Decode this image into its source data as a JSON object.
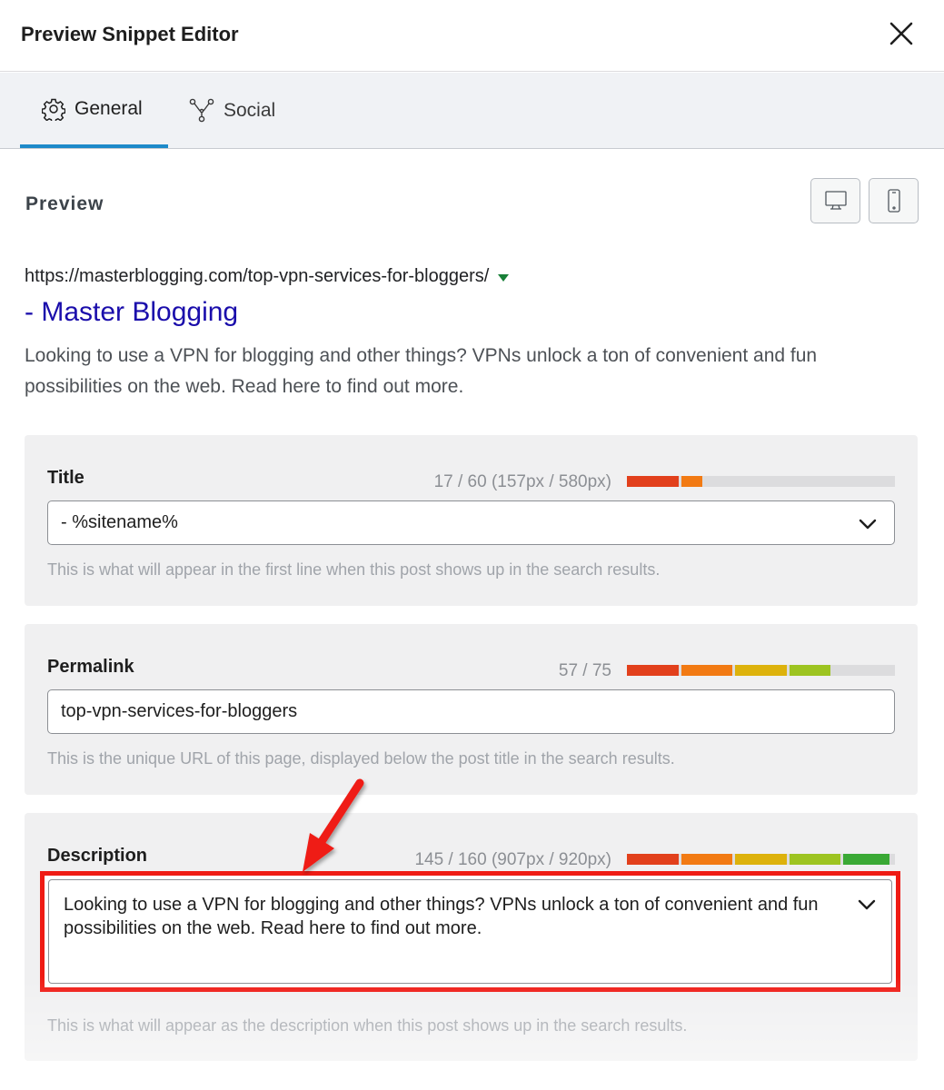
{
  "header": {
    "title": "Preview Snippet Editor",
    "close_icon": "close-icon"
  },
  "tabs": [
    {
      "label": "General",
      "icon": "gear-icon",
      "active": true
    },
    {
      "label": "Social",
      "icon": "share-network-icon",
      "active": false
    }
  ],
  "preview": {
    "label": "Preview",
    "device_buttons": [
      "desktop-icon",
      "mobile-icon"
    ],
    "url": "https://masterblogging.com/top-vpn-services-for-bloggers/",
    "title": "- Master Blogging",
    "description": "Looking to use a VPN for blogging and other things? VPNs unlock a ton of convenient and fun possibilities on the web. Read here to find out more."
  },
  "fields": {
    "title": {
      "label": "Title",
      "counter": "17 / 60 (157px / 580px)",
      "value": "- %sitename%",
      "help": "This is what will appear in the first line when this post shows up in the search results.",
      "meter_fill": 0.28
    },
    "permalink": {
      "label": "Permalink",
      "counter": "57 / 75",
      "value": "top-vpn-services-for-bloggers",
      "help": "This is the unique URL of this page, displayed below the post title in the search results.",
      "meter_fill": 0.76
    },
    "description": {
      "label": "Description",
      "counter": "145 / 160 (907px / 920px)",
      "value": "Looking to use a VPN for blogging and other things? VPNs unlock a ton of convenient and fun possibilities on the web. Read here to find out more.",
      "help": "This is what will appear as the description when this post shows up in the search results.",
      "meter_fill": 0.98
    }
  },
  "colors": {
    "accent": "#1d8ac9",
    "link": "#1a0dab",
    "annotation": "#ef1b14",
    "meter_segments": [
      "#e2401c",
      "#f27a13",
      "#ddb20c",
      "#9dc421",
      "#3aa935"
    ]
  }
}
